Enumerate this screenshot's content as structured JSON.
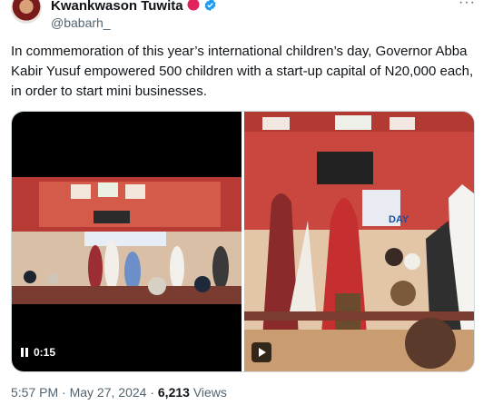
{
  "author": {
    "name": "Kwankwason Tuwita",
    "handle": "@babarh_",
    "badge_color": "#e0245e",
    "verified_color": "#1d9bf0",
    "more_icon": "more-horizontal-icon"
  },
  "tweet": {
    "text": "In commemoration of this year’s international children’s day, Governor Abba Kabir Yusuf empowered 500 children with a start-up capital of N20,000 each, in order to start mini businesses."
  },
  "media": {
    "video1": {
      "time": "0:15",
      "control_icon": "pause-icon"
    },
    "video2": {
      "control_icon": "play-icon",
      "banner_text": "DAY"
    }
  },
  "meta": {
    "time": "5:57 PM",
    "sep1": "·",
    "date": "May 27, 2024",
    "sep2": "·",
    "views_count": "6,213",
    "views_label": "Views"
  }
}
